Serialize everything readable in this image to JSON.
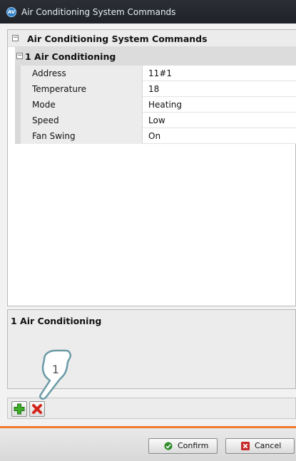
{
  "window": {
    "title": "Air Conditioning System Commands"
  },
  "grid": {
    "category": "Air Conditioning System Commands",
    "subcategory": "1 Air Conditioning",
    "properties": [
      {
        "name": "Address",
        "value": "11#1"
      },
      {
        "name": "Temperature",
        "value": "18"
      },
      {
        "name": "Mode",
        "value": "Heating"
      },
      {
        "name": "Speed",
        "value": "Low"
      },
      {
        "name": "Fan Swing",
        "value": "On"
      }
    ]
  },
  "description": {
    "title": "1 Air Conditioning"
  },
  "callout": {
    "label": "1"
  },
  "buttons": {
    "confirm": "Confirm",
    "cancel": "Cancel"
  },
  "icons": {
    "add": "plus-icon",
    "delete": "x-delete-icon",
    "confirm": "check-icon",
    "cancel": "cancel-icon"
  },
  "colors": {
    "accent": "#ee7a2a",
    "add_icon": "#3fae2a",
    "delete_icon": "#d3241b",
    "confirm_icon": "#2e8b2a",
    "cancel_icon": "#c62a2a"
  }
}
